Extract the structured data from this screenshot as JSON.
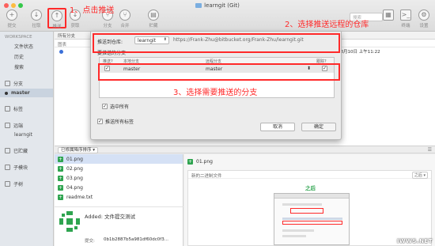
{
  "window": {
    "title": "learngit (Git)"
  },
  "toolbar": {
    "buttons": [
      {
        "label": "提交",
        "glyph": "+"
      },
      {
        "label": "拉取",
        "glyph": "↓"
      },
      {
        "label": "推送",
        "glyph": "↑"
      },
      {
        "label": "获取",
        "glyph": "↓"
      },
      {
        "label": "分支",
        "glyph": "⑂"
      },
      {
        "label": "合并",
        "glyph": "⑂"
      },
      {
        "label": "贮藏",
        "glyph": "▤"
      },
      {
        "label": "在 Finder 中显示",
        "glyph": "▦"
      },
      {
        "label": "终端",
        "glyph": ">_"
      },
      {
        "label": "设置",
        "glyph": "⚙"
      }
    ],
    "search_placeholder": "搜索"
  },
  "sidebar": {
    "workspace_header": "WORKSPACE",
    "workspace_items": [
      "文件状态",
      "历史",
      "搜索"
    ],
    "branches": {
      "label": "分支",
      "items": [
        "master"
      ]
    },
    "tags": {
      "label": "标签"
    },
    "remotes": {
      "label": "远端",
      "items": [
        "learngit"
      ]
    },
    "stashes": {
      "label": "已贮藏"
    },
    "submodules": {
      "label": "子模块"
    },
    "subtrees": {
      "label": "子树"
    }
  },
  "main": {
    "filter_label": "所有分支",
    "column_header": "图表",
    "first_row_date": "2016年8月10日 上午11:22",
    "sort_button": "已修属降序排序 ▾"
  },
  "files": {
    "items": [
      "01.png",
      "02.png",
      "03.png",
      "04.png",
      "readme.txt"
    ]
  },
  "commit": {
    "title": "Added: 文件提交测试",
    "hash_label": "提交:",
    "hash": "0b1b2887b5a981df60dc0f3..."
  },
  "diff": {
    "file_name": "01.png",
    "header": "新的二进制文件",
    "mode": "之后 ▾",
    "after_label": "之后"
  },
  "dialog": {
    "push_to_label": "推送到仓库:",
    "remote_select": "learngit",
    "remote_url": "https://Frank-Zhu@bitbucket.org/Frank-Zhu/learngit.git",
    "branches_label": "要推送的分支",
    "table_headers": {
      "push": "推送?",
      "local": "本地分支",
      "remote": "远程分支",
      "track": "跟踪?"
    },
    "row": {
      "local": "master",
      "remote": "master"
    },
    "select_all": "选中所有",
    "push_tags": "推送所有标签",
    "cancel": "取消",
    "ok": "确定"
  },
  "annotations": {
    "step1": "1、点击推送",
    "step2": "2、选择推送远程的仓库",
    "step3": "3、选择需要推送的分支",
    "accent_color": "#ff2a2a"
  },
  "watermark": "IWWS.NET"
}
